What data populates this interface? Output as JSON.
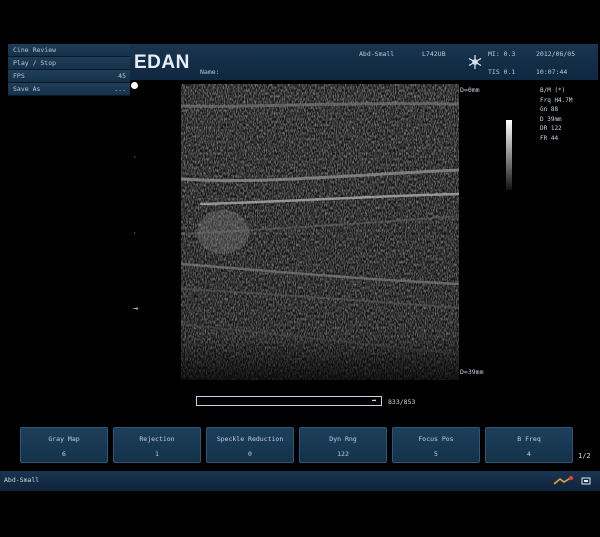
{
  "menu": {
    "items": [
      {
        "label": "Cine Review",
        "value": ""
      },
      {
        "label": "Play / Stop",
        "value": ""
      },
      {
        "label": "FPS",
        "value": "45"
      },
      {
        "label": "Save As",
        "value": "..."
      }
    ]
  },
  "header": {
    "brand": "EDAN",
    "patient_label": "Name:",
    "exam": "Abd-Small",
    "probe": "L742UB",
    "mi": "MI: 0.3",
    "tis": "TIS 0.1",
    "date": "2012/06/05",
    "time": "10:07:44",
    "snowflake_icon": "freeze-icon"
  },
  "image": {
    "depth_top": "D=0mm",
    "depth_bottom": "D=39mm"
  },
  "params": {
    "mode": "B/M (*)",
    "frq": "Frq  H4.7M",
    "gn": "Gn   88",
    "depth": "D    39mm",
    "dr": "DR   122",
    "fr": "FR   44"
  },
  "cine": {
    "counter": "833/853",
    "progress": 0.977
  },
  "softkeys": [
    {
      "label": "Gray Map",
      "value": "6"
    },
    {
      "label": "Rejection",
      "value": "1"
    },
    {
      "label": "Speckle Reduction",
      "value": "0"
    },
    {
      "label": "Dyn Rng",
      "value": "122"
    },
    {
      "label": "Focus Pos",
      "value": "5"
    },
    {
      "label": "B Freq",
      "value": "4"
    }
  ],
  "page_indicator": "1/2",
  "status": {
    "exam_preset": "Abd-Small"
  },
  "colors": {
    "panel": "#16304a",
    "panel_border": "#2b5676",
    "text": "#c8d4e0",
    "background": "#000000"
  }
}
